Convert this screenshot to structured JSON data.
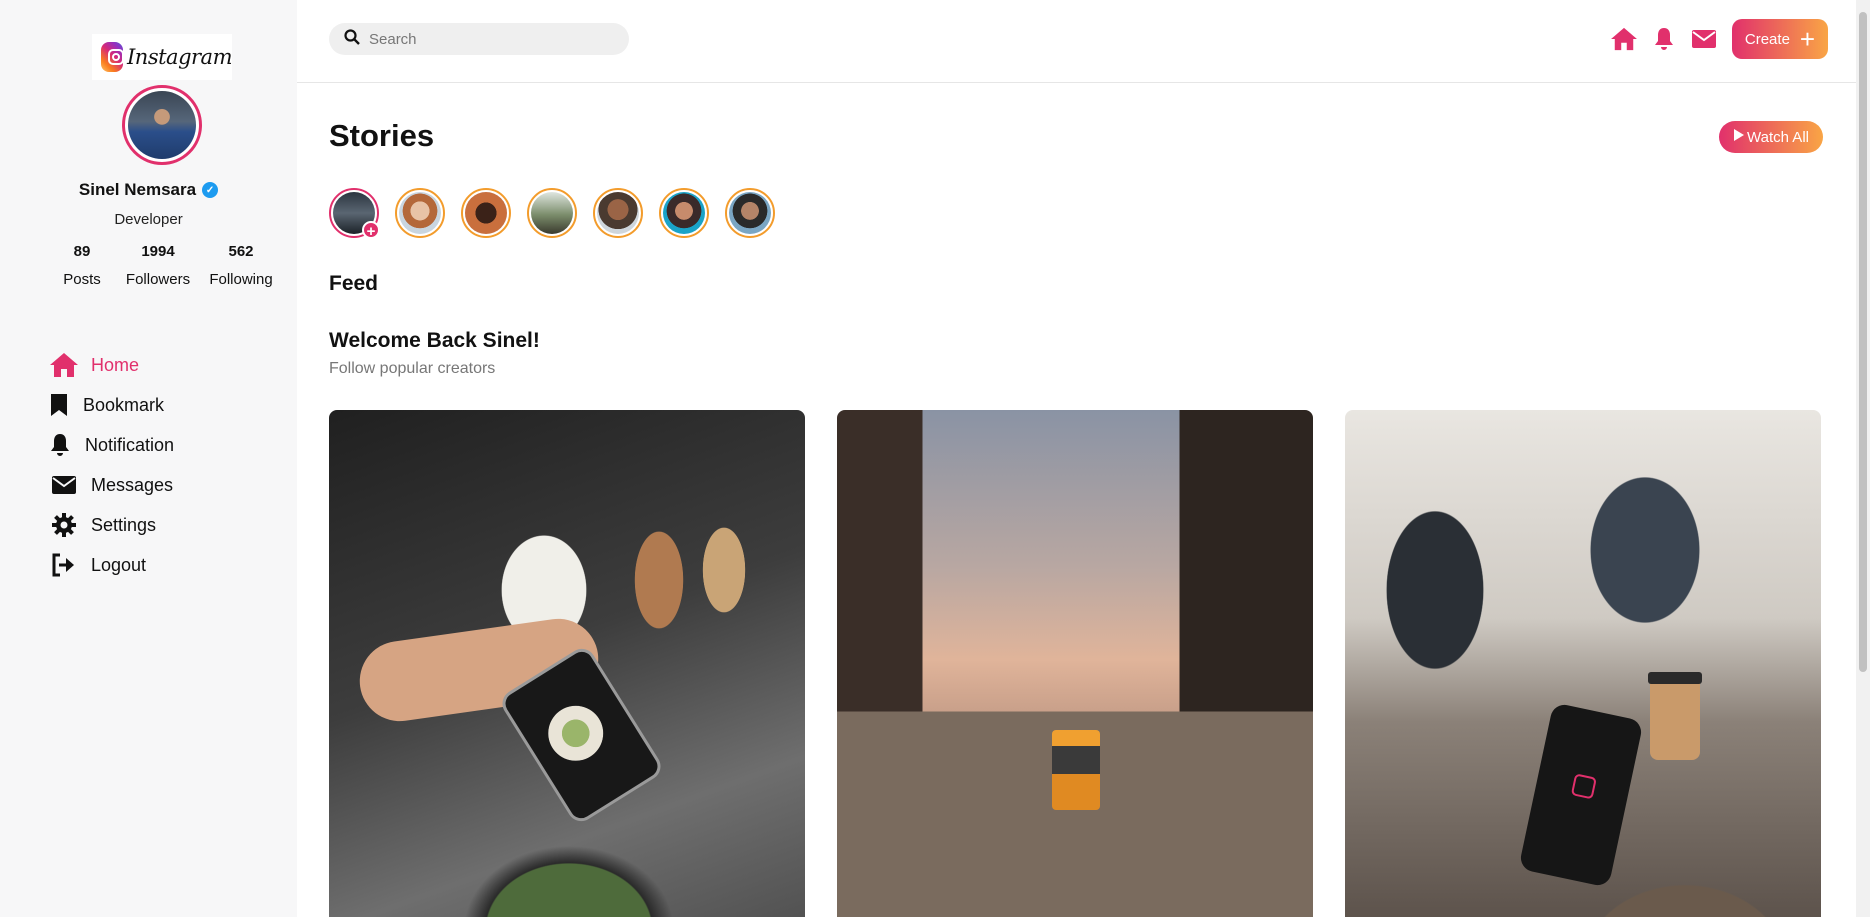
{
  "brand": {
    "logo_text": "Instagram"
  },
  "profile": {
    "name": "Sinel Nemsara",
    "role": "Developer"
  },
  "stats": [
    {
      "value": "89",
      "label": "Posts"
    },
    {
      "value": "1994",
      "label": "Followers"
    },
    {
      "value": "562",
      "label": "Following"
    }
  ],
  "nav": [
    {
      "label": "Home",
      "icon": "home-icon",
      "active": true
    },
    {
      "label": "Bookmark",
      "icon": "bookmark-icon"
    },
    {
      "label": "Notification",
      "icon": "bell-icon"
    },
    {
      "label": "Messages",
      "icon": "envelope-icon"
    },
    {
      "label": "Settings",
      "icon": "gear-icon"
    },
    {
      "label": "Logout",
      "icon": "logout-icon"
    }
  ],
  "topbar": {
    "search_placeholder": "Search",
    "create_label": "Create"
  },
  "stories": {
    "title": "Stories",
    "watch_all_label": "Watch All"
  },
  "feed": {
    "title": "Feed",
    "welcome": "Welcome Back Sinel!",
    "subtitle": "Follow popular creators"
  },
  "colors": {
    "accent": "#e1306c",
    "gradient_end": "#f9a545",
    "story_ring": "#f39c2c"
  }
}
